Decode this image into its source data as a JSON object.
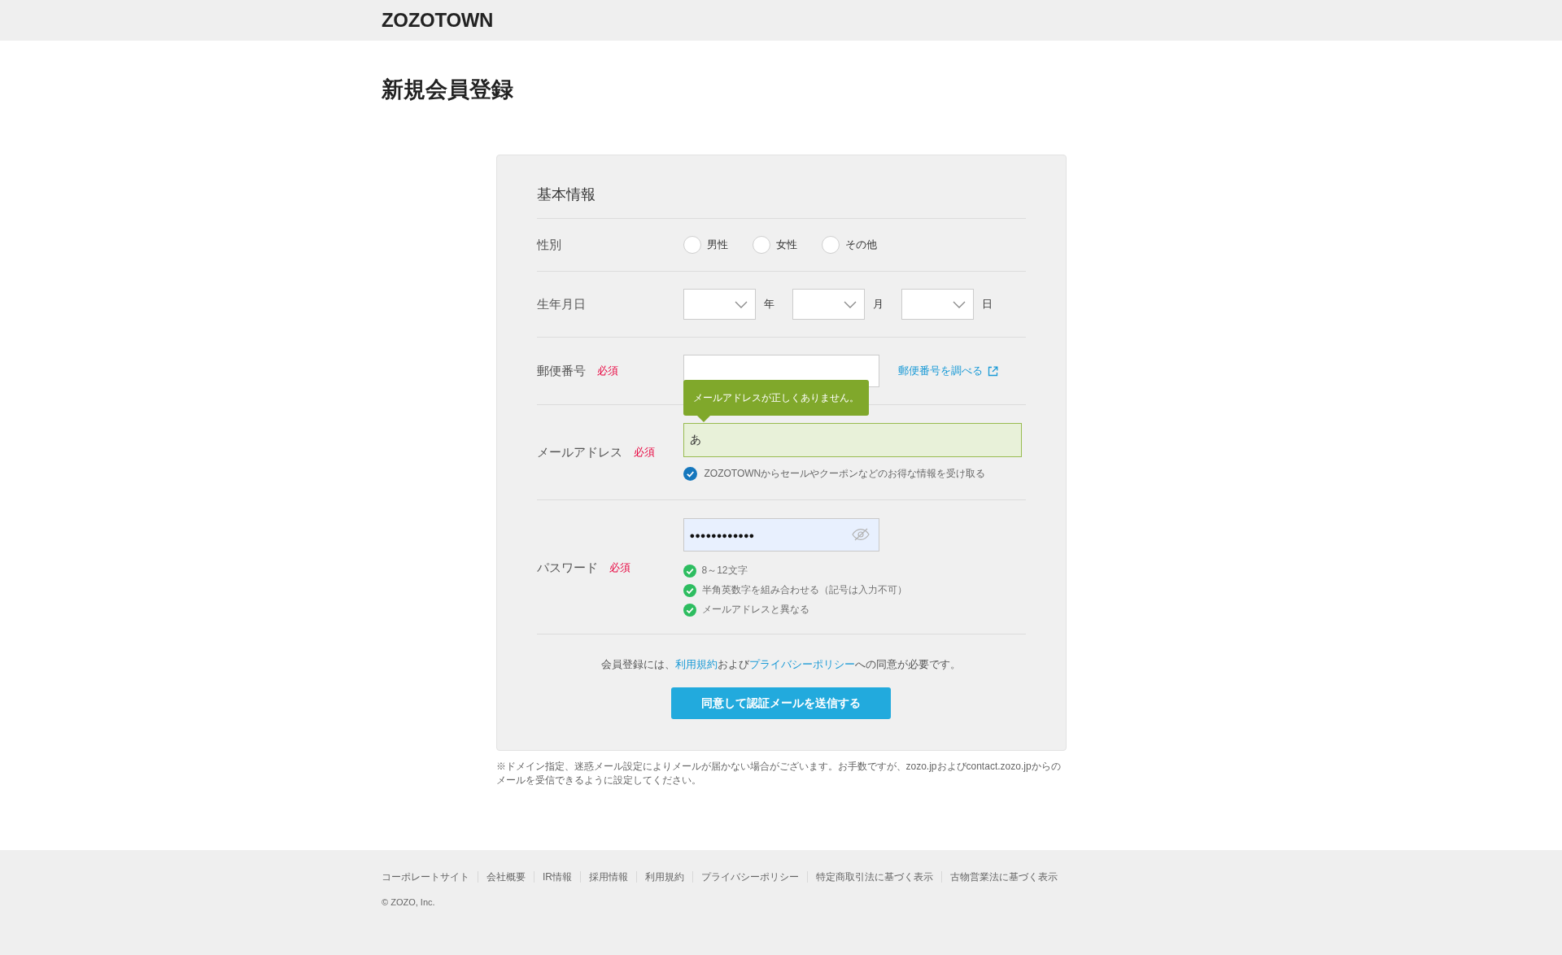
{
  "header": {
    "logo": "ZOZOTOWN"
  },
  "page_title": "新規会員登録",
  "form": {
    "section_title": "基本情報",
    "rows": [
      {
        "kind": "radio",
        "label": "性別",
        "options": [
          {
            "label": "男性",
            "selected": false
          },
          {
            "label": "女性",
            "selected": false
          },
          {
            "label": "その他",
            "selected": false
          }
        ]
      },
      {
        "kind": "date",
        "label": "生年月日",
        "parts": [
          {
            "unit": "年"
          },
          {
            "unit": "月"
          },
          {
            "unit": "日"
          }
        ]
      },
      {
        "kind": "postal",
        "label": "郵便番号",
        "required": "必須",
        "link": "郵便番号を調べる"
      },
      {
        "kind": "email",
        "label": "メールアドレス",
        "required": "必須",
        "value": "あ",
        "error": "メールアドレスが正しくありません。",
        "opt_in": {
          "label": "ZOZOTOWNからセールやクーポンなどのお得な情報を受け取る",
          "checked": true
        }
      },
      {
        "kind": "password",
        "label": "パスワード",
        "required": "必須",
        "value": "●●●●●●●●●●●●",
        "rules": [
          {
            "text": "8～12文字",
            "met": true
          },
          {
            "text": "半角英数字を組み合わせる（記号は入力不可）",
            "met": true
          },
          {
            "text": "メールアドレスと異なる",
            "met": true
          }
        ]
      }
    ],
    "agreement": [
      {
        "kind": "text",
        "text": "会員登録には、"
      },
      {
        "kind": "link",
        "text": "利用規約"
      },
      {
        "kind": "text",
        "text": "および"
      },
      {
        "kind": "link",
        "text": "プライバシーポリシー"
      },
      {
        "kind": "text",
        "text": "への同意が必要です。"
      }
    ],
    "submit": "同意して認証メールを送信する"
  },
  "note": "※ドメイン指定、迷惑メール設定によりメールが届かない場合がございます。お手数ですが、zozo.jpおよびcontact.zozo.jpからのメールを受信できるように設定してください。",
  "footer": {
    "links": [
      "コーポレートサイト",
      "会社概要",
      "IR情報",
      "採用情報",
      "利用規約",
      "プライバシーポリシー",
      "特定商取引法に基づく表示",
      "古物営業法に基づく表示"
    ],
    "copyright": "© ZOZO, Inc."
  }
}
